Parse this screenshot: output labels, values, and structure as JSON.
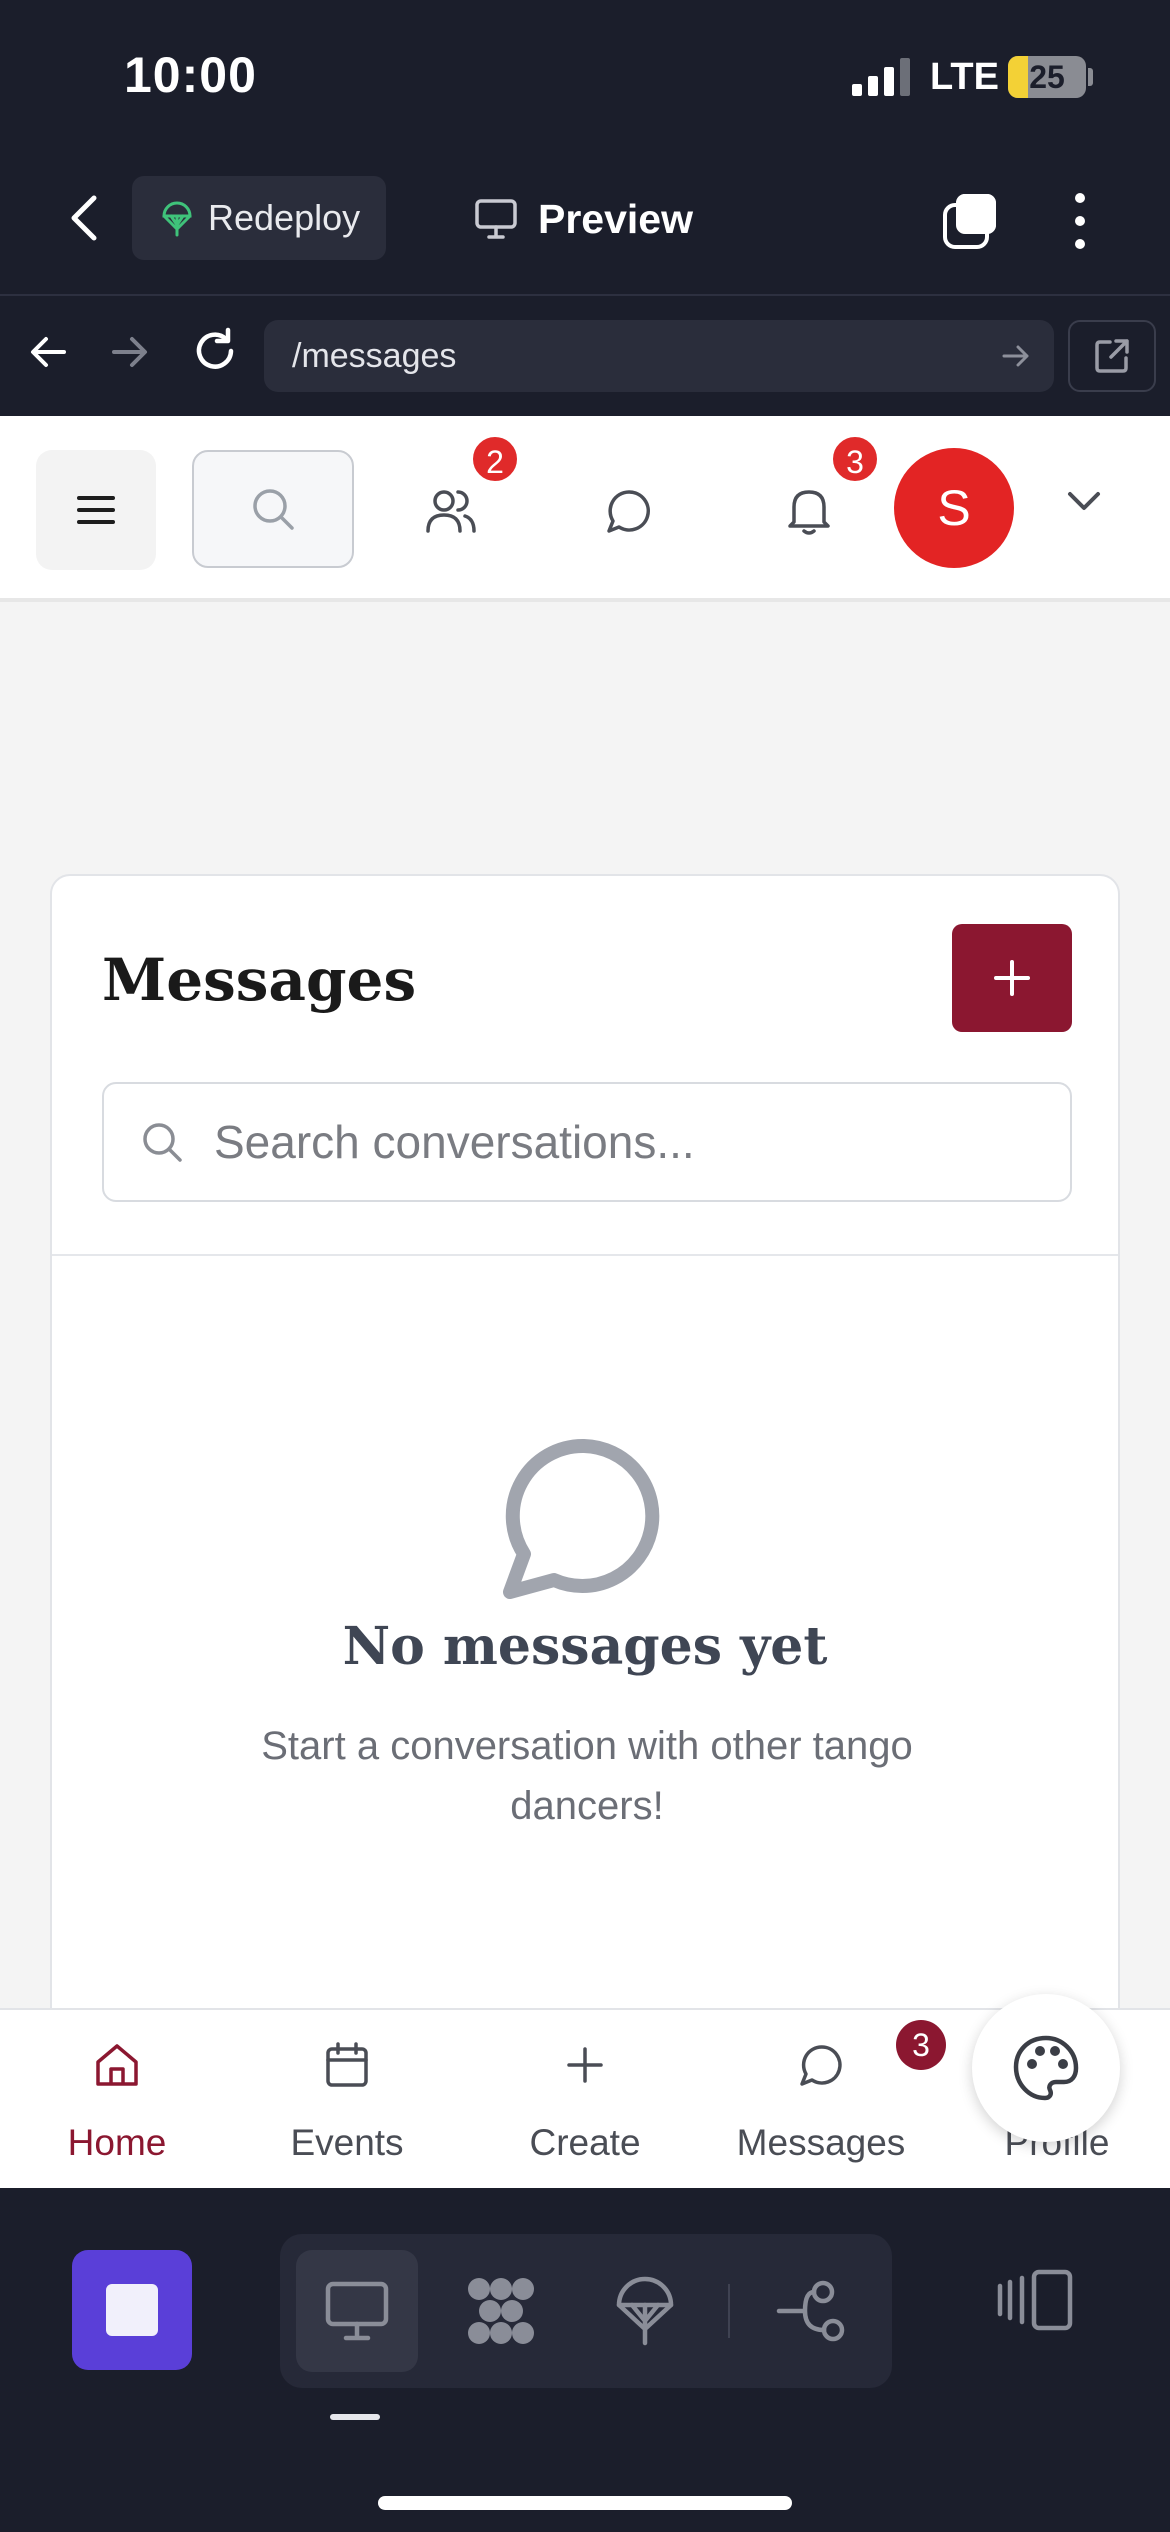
{
  "status_bar": {
    "time": "10:00",
    "network": "LTE",
    "battery": "25",
    "battery_level": 0.25
  },
  "toolbar": {
    "redeploy_label": "Redeploy",
    "preview_label": "Preview"
  },
  "address_bar": {
    "url": "/messages"
  },
  "app_header": {
    "friends_badge": "2",
    "notifications_badge": "3",
    "avatar_initial": "S"
  },
  "messages_card": {
    "title": "Messages",
    "new_button": "+",
    "search_placeholder": "Search conversations...",
    "empty_title": "No messages yet",
    "empty_description": "Start a conversation with other tango dancers!"
  },
  "tab_bar": {
    "tabs": [
      {
        "label": "Home",
        "icon": "home-icon",
        "active": true
      },
      {
        "label": "Events",
        "icon": "calendar-icon",
        "active": false
      },
      {
        "label": "Create",
        "icon": "plus-icon",
        "active": false
      },
      {
        "label": "Messages",
        "icon": "chat-icon",
        "active": false
      },
      {
        "label": "Profile",
        "icon": "user-icon",
        "active": false
      }
    ],
    "messages_badge": "3"
  },
  "colors": {
    "brand": "#8b1730",
    "badge_red": "#e02a2a",
    "avatar": "#e32424",
    "dock_accent": "#5a3fd8"
  }
}
